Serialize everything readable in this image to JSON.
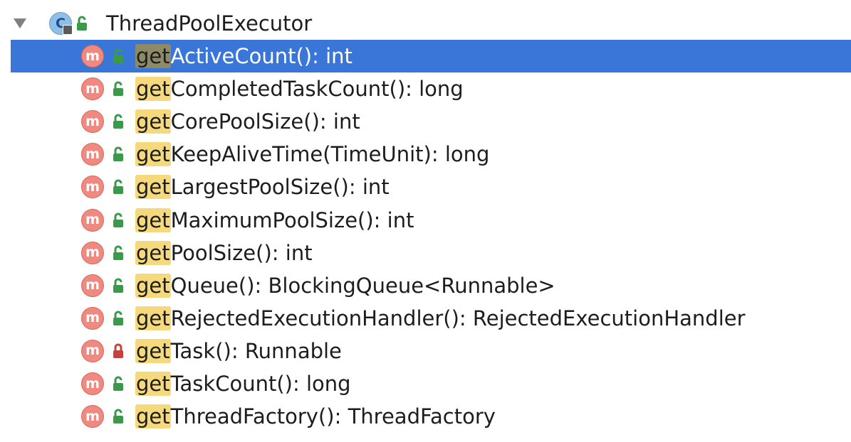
{
  "popup": {
    "class_name": "ThreadPoolExecutor",
    "class_icon_letter": "C",
    "method_icon_letter": "m",
    "highlight_prefix": "get",
    "methods": [
      {
        "rest": "ActiveCount(): int",
        "access": "public",
        "selected": true
      },
      {
        "rest": "CompletedTaskCount(): long",
        "access": "public",
        "selected": false
      },
      {
        "rest": "CorePoolSize(): int",
        "access": "public",
        "selected": false
      },
      {
        "rest": "KeepAliveTime(TimeUnit): long",
        "access": "public",
        "selected": false
      },
      {
        "rest": "LargestPoolSize(): int",
        "access": "public",
        "selected": false
      },
      {
        "rest": "MaximumPoolSize(): int",
        "access": "public",
        "selected": false
      },
      {
        "rest": "PoolSize(): int",
        "access": "public",
        "selected": false
      },
      {
        "rest": "Queue(): BlockingQueue<Runnable>",
        "access": "public",
        "selected": false
      },
      {
        "rest": "RejectedExecutionHandler(): RejectedExecutionHandler",
        "access": "public",
        "selected": false
      },
      {
        "rest": "Task(): Runnable",
        "access": "private",
        "selected": false
      },
      {
        "rest": "TaskCount(): long",
        "access": "public",
        "selected": false
      },
      {
        "rest": "ThreadFactory(): ThreadFactory",
        "access": "public",
        "selected": false
      }
    ]
  },
  "colors": {
    "selection": "#3976d7",
    "get_highlight": "#f6d97d",
    "public_lock": "#3a9a4a",
    "private_lock": "#c9413b",
    "method_icon": "#f08a80"
  }
}
